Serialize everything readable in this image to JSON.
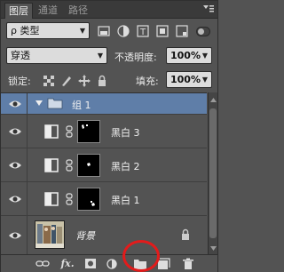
{
  "tabs": [
    {
      "label": "图层"
    },
    {
      "label": "通道"
    },
    {
      "label": "路径"
    }
  ],
  "filter": {
    "kind_label": "ρ 类型"
  },
  "blend": {
    "mode": "穿透",
    "opacity_label": "不透明度:",
    "opacity_value": "100%"
  },
  "lock": {
    "label": "锁定:",
    "fill_label": "填充:",
    "fill_value": "100%"
  },
  "layers": [
    {
      "name": "组 1",
      "type": "group"
    },
    {
      "name": "黑白 3",
      "type": "adjustment"
    },
    {
      "name": "黑白 2",
      "type": "adjustment"
    },
    {
      "name": "黑白 1",
      "type": "adjustment"
    },
    {
      "name": "背景",
      "type": "background"
    }
  ],
  "toolbar": {
    "fx_label": "fx."
  },
  "colors": {
    "panel_bg": "#535353",
    "group_highlight": "#5f7ea8",
    "annotation_ring": "#e31b1b"
  }
}
